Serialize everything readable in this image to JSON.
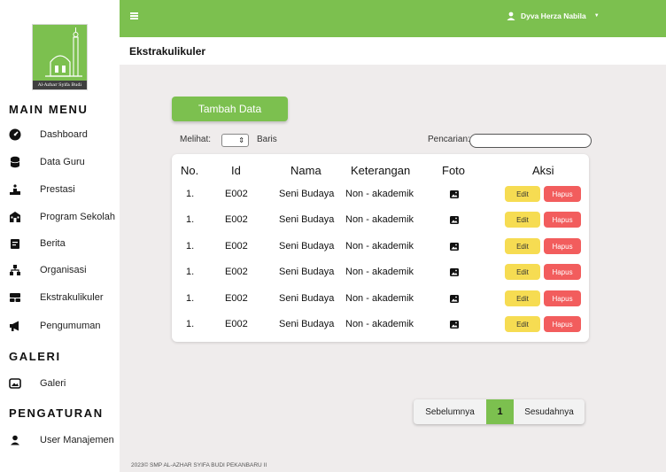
{
  "sidebar": {
    "logo_caption": "Al-Azhar Syifa Budi",
    "main_menu_title": "MAIN MENU",
    "main_items": [
      {
        "label": "Dashboard",
        "icon": "dashboard-icon"
      },
      {
        "label": "Data Guru",
        "icon": "database-icon"
      },
      {
        "label": "Prestasi",
        "icon": "podium-icon"
      },
      {
        "label": "Program Sekolah",
        "icon": "school-icon"
      },
      {
        "label": "Berita",
        "icon": "news-icon"
      },
      {
        "label": "Organisasi",
        "icon": "organization-icon"
      },
      {
        "label": "Ekstrakulikuler",
        "icon": "grid-icon"
      },
      {
        "label": "Pengumuman",
        "icon": "megaphone-icon"
      }
    ],
    "gallery_title": "GALERI",
    "gallery_items": [
      {
        "label": "Galeri",
        "icon": "image-icon"
      }
    ],
    "settings_title": "PENGATURAN",
    "settings_items": [
      {
        "label": "User Manajemen",
        "icon": "user-icon"
      }
    ]
  },
  "topbar": {
    "user_name": "Dyva Herza Nabila",
    "colors": {
      "accent": "#7cc04f"
    }
  },
  "header": {
    "title": "Ekstrakulikuler"
  },
  "toolbar": {
    "add_label": "Tambah Data",
    "show_label": "Melihat:",
    "rows_label": "Baris",
    "search_label": "Pencarian:",
    "search_value": ""
  },
  "table": {
    "columns": [
      "No.",
      "Id",
      "Nama",
      "Keterangan",
      "Foto",
      "Aksi"
    ],
    "rows": [
      {
        "no": "1.",
        "id": "E002",
        "nama": "Seni Budaya",
        "keterangan": "Non - akademik"
      },
      {
        "no": "1.",
        "id": "E002",
        "nama": "Seni Budaya",
        "keterangan": "Non - akademik"
      },
      {
        "no": "1.",
        "id": "E002",
        "nama": "Seni Budaya",
        "keterangan": "Non - akademik"
      },
      {
        "no": "1.",
        "id": "E002",
        "nama": "Seni Budaya",
        "keterangan": "Non - akademik"
      },
      {
        "no": "1.",
        "id": "E002",
        "nama": "Seni Budaya",
        "keterangan": "Non - akademik"
      },
      {
        "no": "1.",
        "id": "E002",
        "nama": "Seni Budaya",
        "keterangan": "Non - akademik"
      }
    ],
    "edit_label": "Edit",
    "delete_label": "Hapus",
    "colors": {
      "edit": "#f6dc52",
      "delete": "#f25d5d"
    }
  },
  "pagination": {
    "prev_label": "Sebelumnya",
    "current_page": "1",
    "next_label": "Sesudahnya"
  },
  "footer": {
    "text": "2023© SMP AL-AZHAR SYIFA BUDI PEKANBARU II"
  }
}
